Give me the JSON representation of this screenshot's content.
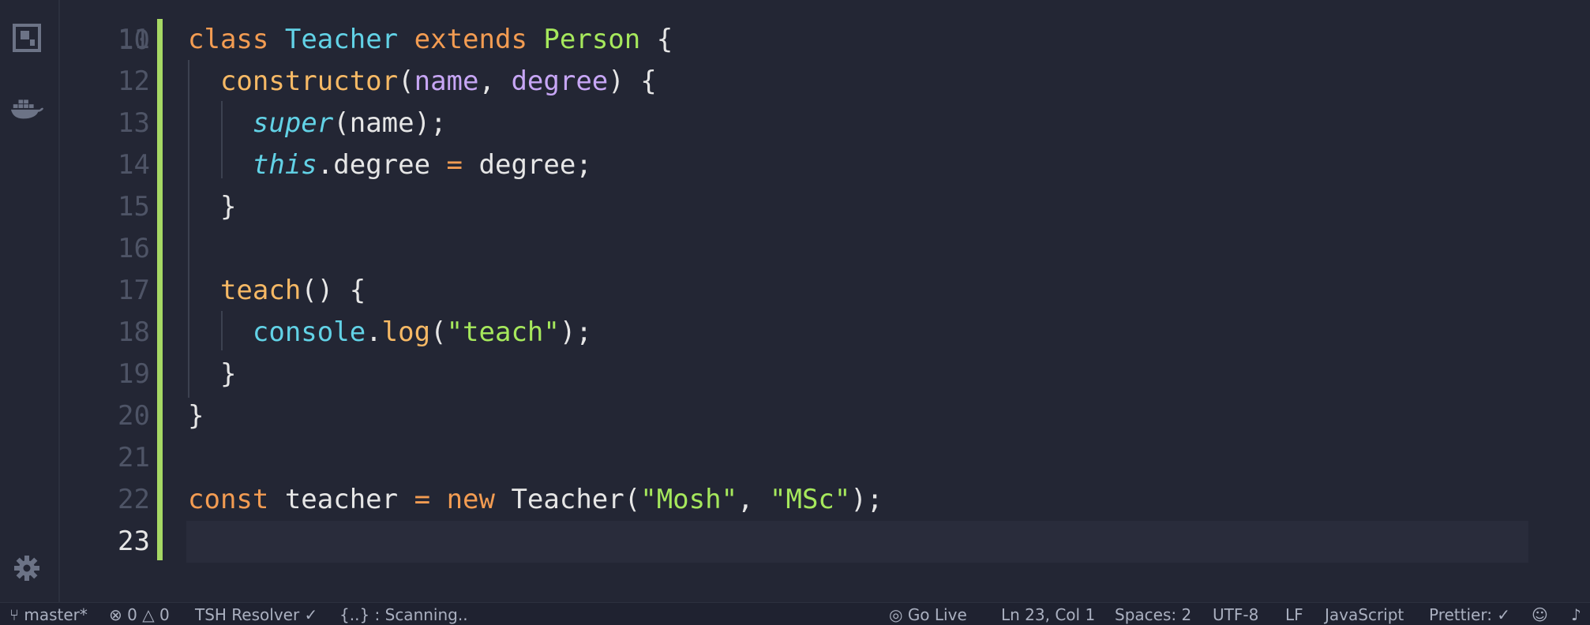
{
  "editor": {
    "partial_line_number": "10",
    "lines": [
      {
        "n": "11",
        "tokens": [
          {
            "t": "class",
            "c": "kw"
          },
          {
            "t": " "
          },
          {
            "t": "Teacher",
            "c": "cls"
          },
          {
            "t": " "
          },
          {
            "t": "extends",
            "c": "kw"
          },
          {
            "t": " "
          },
          {
            "t": "Person",
            "c": "inh"
          },
          {
            "t": " {"
          }
        ]
      },
      {
        "n": "12",
        "tokens": [
          {
            "t": "  "
          },
          {
            "t": "constructor",
            "c": "fn"
          },
          {
            "t": "("
          },
          {
            "t": "name",
            "c": "param"
          },
          {
            "t": ", "
          },
          {
            "t": "degree",
            "c": "param"
          },
          {
            "t": ") {"
          }
        ]
      },
      {
        "n": "13",
        "tokens": [
          {
            "t": "    "
          },
          {
            "t": "super",
            "c": "ital"
          },
          {
            "t": "(name);"
          }
        ]
      },
      {
        "n": "14",
        "tokens": [
          {
            "t": "    "
          },
          {
            "t": "this",
            "c": "ital"
          },
          {
            "t": ".degree "
          },
          {
            "t": "=",
            "c": "op"
          },
          {
            "t": " degree;"
          }
        ]
      },
      {
        "n": "15",
        "tokens": [
          {
            "t": "  }"
          }
        ]
      },
      {
        "n": "16",
        "tokens": []
      },
      {
        "n": "17",
        "tokens": [
          {
            "t": "  "
          },
          {
            "t": "teach",
            "c": "fn"
          },
          {
            "t": "() {"
          }
        ]
      },
      {
        "n": "18",
        "tokens": [
          {
            "t": "    "
          },
          {
            "t": "console",
            "c": "obj"
          },
          {
            "t": "."
          },
          {
            "t": "log",
            "c": "fn"
          },
          {
            "t": "("
          },
          {
            "t": "\"teach\"",
            "c": "str"
          },
          {
            "t": ");"
          }
        ]
      },
      {
        "n": "19",
        "tokens": [
          {
            "t": "  }"
          }
        ]
      },
      {
        "n": "20",
        "tokens": [
          {
            "t": "}"
          }
        ]
      },
      {
        "n": "21",
        "tokens": []
      },
      {
        "n": "22",
        "tokens": [
          {
            "t": "const",
            "c": "kw"
          },
          {
            "t": " teacher "
          },
          {
            "t": "=",
            "c": "op"
          },
          {
            "t": " "
          },
          {
            "t": "new",
            "c": "kw"
          },
          {
            "t": " Teacher("
          },
          {
            "t": "\"Mosh\"",
            "c": "str"
          },
          {
            "t": ", "
          },
          {
            "t": "\"MSc\"",
            "c": "str"
          },
          {
            "t": ");"
          }
        ]
      },
      {
        "n": "23",
        "tokens": [],
        "current": true
      }
    ]
  },
  "activity_bar": {
    "icons": [
      "extension-box-icon",
      "docker-icon",
      "settings-gear-icon"
    ]
  },
  "status_bar": {
    "branch": "master*",
    "errors": "0",
    "warnings": "0",
    "tsh_resolver": "TSH Resolver ✓",
    "scanning": "{..} : Scanning..",
    "go_live": "Go Live",
    "position": "Ln 23, Col 1",
    "spaces": "Spaces: 2",
    "encoding": "UTF-8",
    "eol": "LF",
    "language": "JavaScript",
    "formatter": "Prettier: ✓"
  },
  "colors": {
    "background": "#232634",
    "gutter_marker": "#a6d864",
    "keyword": "#f39c52",
    "class_name": "#62d2e6",
    "string": "#a6e85c",
    "parameter": "#c7a6f5",
    "function": "#f6b965"
  }
}
